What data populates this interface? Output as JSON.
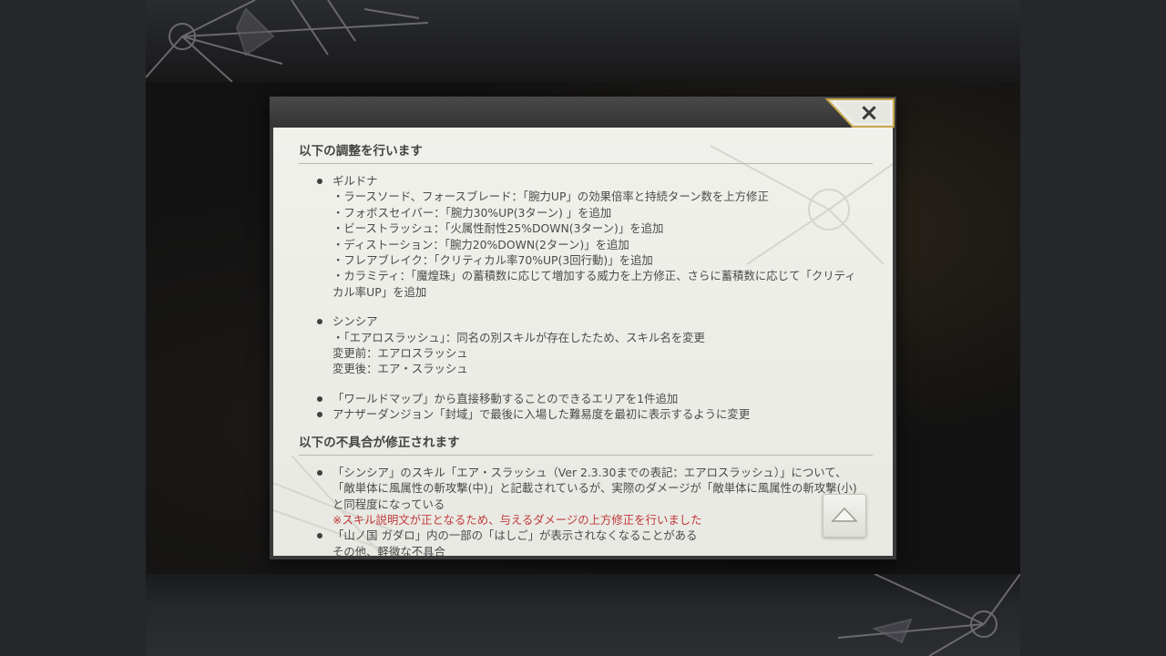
{
  "dialog": {
    "close_label": "×",
    "sections": [
      {
        "title": "以下の調整を行います",
        "items": [
          {
            "head": "ギルドナ",
            "lines": [
              "・ラースソード、フォースブレード：「腕力UP」の効果倍率と持続ターン数を上方修正",
              "・フォボスセイバー：「腕力30%UP(3ターン) 」を追加",
              "・ビーストラッシュ：「火属性耐性25%DOWN(3ターン)」を追加",
              "・ディストーション：「腕力20%DOWN(2ターン)」を追加",
              "・フレアブレイク：「クリティカル率70%UP(3回行動)」を追加",
              "・カラミティ：「魔煌珠」の蓄積数に応じて増加する威力を上方修正、さらに蓄積数に応じて「クリティ",
              "カル率UP」を追加"
            ]
          },
          {
            "head": "シンシア",
            "lines": [
              "・「エアロスラッシュ」：同名の別スキルが存在したため、スキル名を変更",
              "変更前：エアロスラッシュ",
              "変更後：エア・スラッシュ"
            ]
          },
          {
            "head": "「ワールドマップ」から直接移動することのできるエリアを1件追加"
          },
          {
            "head": "アナザーダンジョン「封域」で最後に入場した難易度を最初に表示するように変更"
          }
        ]
      },
      {
        "title": "以下の不具合が修正されます",
        "items": [
          {
            "head": "「シンシア」のスキル「エア・スラッシュ（Ver 2.3.30までの表記：エアロスラッシュ）」について、",
            "lines": [
              "「敵単体に風属性の斬攻撃(中)」と記載されているが、実際のダメージが「敵単体に風属性の斬攻撃(小)",
              "と同程度になっている"
            ],
            "note": "※スキル説明文が正となるため、与えるダメージの上方修正を行いました"
          },
          {
            "head": "「山ノ国 ガダロ」内の一部の「はしご」が表示されなくなることがある",
            "lines": [
              "その他、軽微な不具合"
            ]
          }
        ]
      }
    ],
    "scroll_up_icon": "triangle-up-icon"
  },
  "colors": {
    "modal_bg": "#f1f1ec",
    "text": "#4a4a4a",
    "note": "#c0393b",
    "header": "#3a3a3a",
    "close_border": "#c9a84a"
  }
}
